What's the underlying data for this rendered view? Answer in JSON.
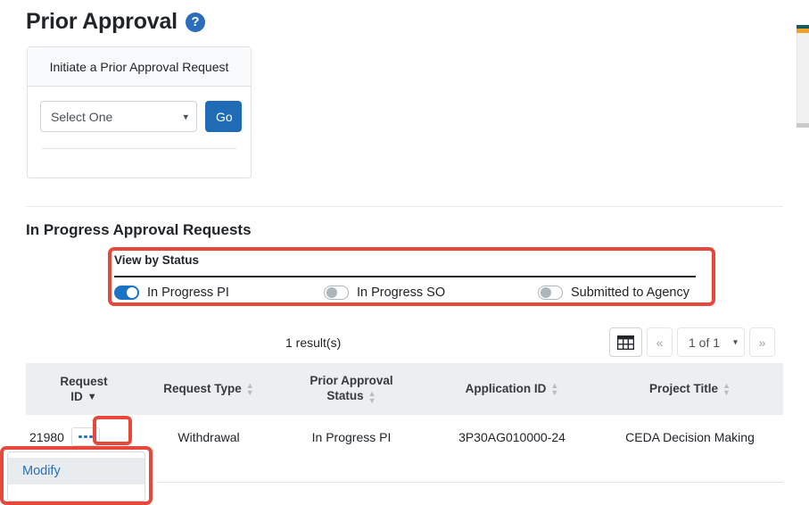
{
  "page": {
    "title": "Prior Approval",
    "help_icon_glyph": "?",
    "help_icon_name": "question-mark-circle-icon"
  },
  "initiate_card": {
    "header": "Initiate a Prior Approval Request",
    "select_value": "Select One",
    "select_options": [
      "Select One"
    ],
    "go_label": "Go"
  },
  "in_progress_section": {
    "heading": "In Progress Approval Requests",
    "status_filter": {
      "label": "View by Status",
      "toggles": [
        {
          "label": "In Progress PI",
          "on": true
        },
        {
          "label": "In Progress SO",
          "on": false
        },
        {
          "label": "Submitted to Agency",
          "on": false
        }
      ]
    },
    "result_count": "1 result(s)",
    "pager": {
      "grid_icon": "table-grid-icon",
      "prev_label": "«",
      "next_label": "»",
      "page_value": "1 of 1",
      "page_options": [
        "1 of 1"
      ]
    },
    "table": {
      "columns": [
        {
          "line1": "Request",
          "line2": "ID",
          "sorted": true,
          "sort_dir": "desc"
        },
        {
          "line1": "",
          "line2": "Request Type",
          "sorted": false
        },
        {
          "line1": "Prior Approval",
          "line2": "Status",
          "sorted": false
        },
        {
          "line1": "",
          "line2": "Application ID",
          "sorted": false
        },
        {
          "line1": "",
          "line2": "Project Title",
          "sorted": false
        }
      ],
      "rows": [
        {
          "request_id": "21980",
          "actions_label": "row-actions",
          "request_type": "Withdrawal",
          "prior_approval_status": "In Progress PI",
          "application_id": "3P30AG010000-24",
          "project_title": "CEDA Decision Making"
        }
      ]
    },
    "row_menu": {
      "items": [
        "Modify"
      ]
    }
  },
  "colors": {
    "accent_blue": "#1f6cb5",
    "link_blue": "#2a6ebb",
    "highlight_red": "#e8483c",
    "toggle_on": "#1a73c4",
    "header_bg": "#eceef0"
  }
}
